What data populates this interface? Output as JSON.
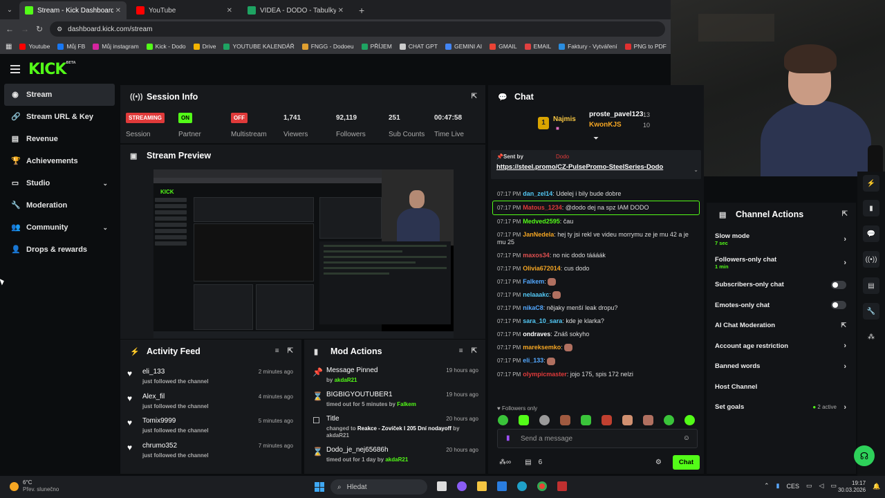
{
  "browser": {
    "tabs": [
      {
        "title": "Stream - Kick Dashboard",
        "color": "#53fc18",
        "active": true
      },
      {
        "title": "YouTube",
        "color": "#ff0000",
        "active": false
      },
      {
        "title": "VIDEA - DODO - Tabulky Googl",
        "color": "#1ea362",
        "active": false
      }
    ],
    "url": "dashboard.kick.com/stream",
    "bookmarks": [
      {
        "label": "Youtube",
        "color": "#ff0000"
      },
      {
        "label": "Můj FB",
        "color": "#1877f2"
      },
      {
        "label": "Můj instagram",
        "color": "#d6249f"
      },
      {
        "label": "Kick - Dodo",
        "color": "#53fc18"
      },
      {
        "label": "Drive",
        "color": "#f4b400"
      },
      {
        "label": "YOUTUBE KALENDÁŘ",
        "color": "#1ea362"
      },
      {
        "label": "FNGG - Dodoeu",
        "color": "#e0a030"
      },
      {
        "label": "PŘÍJEM",
        "color": "#1ea362"
      },
      {
        "label": "CHAT GPT",
        "color": "#cccccc"
      },
      {
        "label": "GEMINI AI",
        "color": "#4285f4"
      },
      {
        "label": "GMAIL",
        "color": "#ea4335"
      },
      {
        "label": "EMAIL",
        "color": "#e04040"
      },
      {
        "label": "Faktury - Vytváření",
        "color": "#2a8de0"
      },
      {
        "label": "PNG to PDF",
        "color": "#e03030"
      }
    ]
  },
  "logo": {
    "text": "KICK",
    "sup": "BETA"
  },
  "sidebar": [
    {
      "label": "Stream",
      "icon": "◉",
      "active": true,
      "chev": false
    },
    {
      "label": "Stream URL & Key",
      "icon": "🔗",
      "chev": false
    },
    {
      "label": "Revenue",
      "icon": "▤",
      "chev": false
    },
    {
      "label": "Achievements",
      "icon": "🏆",
      "chev": false
    },
    {
      "label": "Studio",
      "icon": "▭",
      "chev": true
    },
    {
      "label": "Moderation",
      "icon": "🔧",
      "chev": false
    },
    {
      "label": "Community",
      "icon": "👥",
      "chev": true
    },
    {
      "label": "Drops & rewards",
      "icon": "👤",
      "chev": false
    }
  ],
  "session": {
    "title": "Session Info",
    "stats": [
      {
        "badge": "STREAMING",
        "badge_color": "#e03a3a",
        "label": "Session"
      },
      {
        "badge": "ON",
        "badge_color": "#53fc18",
        "label": "Partner"
      },
      {
        "badge": "OFF",
        "badge_color": "#e03a3a",
        "label": "Multistream"
      },
      {
        "value": "1,741",
        "label": "Viewers"
      },
      {
        "value": "92,119",
        "label": "Followers"
      },
      {
        "value": "251",
        "label": "Sub Counts"
      },
      {
        "value": "00:47:58",
        "label": "Time Live"
      }
    ]
  },
  "preview": {
    "title": "Stream Preview"
  },
  "activity": {
    "title": "Activity Feed",
    "items": [
      {
        "name": "eli_133",
        "text": "just followed the channel",
        "time": "2 minutes ago"
      },
      {
        "name": "Alex_fil",
        "text": "just followed the channel",
        "time": "4 minutes ago"
      },
      {
        "name": "Tomix9999",
        "text": "just followed the channel",
        "time": "5 minutes ago"
      },
      {
        "name": "chrumo352",
        "text": "just followed the channel",
        "time": "7 minutes ago"
      }
    ]
  },
  "mod": {
    "title": "Mod Actions",
    "items": [
      {
        "icon": "📌",
        "name": "Message Pinned",
        "pre": "by",
        "target": "akdaR21",
        "post": "",
        "time": "19 hours ago",
        "h": 35
      },
      {
        "icon": "⌛",
        "name": "BIGBIGYOUTUBER1",
        "pre": "timed out for 5 minutes by",
        "target": "Falkem",
        "post": "",
        "time": "19 hours ago",
        "h": 35
      },
      {
        "icon": "☐",
        "name": "Title",
        "pre": "changed to",
        "target": "Reakce - Zovíček I 205 Dní nodayoff",
        "post": " by akdaR21",
        "time": "20 hours ago",
        "h": 45
      },
      {
        "icon": "⌛",
        "name": "Dodo_je_nej65686h",
        "pre": "timed out for 1 day by",
        "target": "akdaR21",
        "post": "",
        "time": "20 hours ago",
        "h": 30
      }
    ]
  },
  "chat": {
    "title": "Chat",
    "top": {
      "rank1": "Najmis",
      "rank1_count": "1",
      "second": "proste_pavel123",
      "second_count": "13",
      "third": "KwonKJS",
      "third_count": "10"
    },
    "pinned": {
      "label": "Sent by",
      "user": "Dodo",
      "link": "https://steel.promo/CZ-PulsePromo-SteelSeries-Dodo"
    },
    "messages": [
      {
        "time": "07:17 PM",
        "user": "dan_zel14",
        "color": "#53c8f5",
        "text": "Udelej i bily bude dobre"
      },
      {
        "time": "07:17 PM",
        "user": "Matous_1234",
        "color": "#e03a3a",
        "text": "@dodo dej na spz IAM DODO",
        "highlight": true
      },
      {
        "time": "07:17 PM",
        "user": "Medved2595",
        "color": "#53fc18",
        "text": "čau"
      },
      {
        "time": "07:17 PM",
        "user": "JanNedela",
        "color": "#f5a623",
        "text": "hej ty jsi rekl ve videu morrymu ze je mu 42 a je mu 25"
      },
      {
        "time": "07:17 PM",
        "user": "maxos34",
        "color": "#e05050",
        "text": "no nic dodo táááák"
      },
      {
        "time": "07:17 PM",
        "user": "Olivia672014",
        "color": "#f5a623",
        "text": "cus dodo"
      },
      {
        "time": "07:17 PM",
        "user": "Falkem",
        "color": "#53a8ff",
        "text": ""
      },
      {
        "time": "07:17 PM",
        "user": "nelaaakc",
        "color": "#53c8f5",
        "text": ""
      },
      {
        "time": "07:17 PM",
        "user": "nikaC8",
        "color": "#53a8ff",
        "text": "nějaky menší leak dropu?"
      },
      {
        "time": "07:17 PM",
        "user": "sara_10_sara",
        "color": "#53c8f5",
        "text": "kde je klarka?"
      },
      {
        "time": "07:17 PM",
        "user": "ondraves",
        "color": "#ffffff",
        "text": "Znáš sokyho"
      },
      {
        "time": "07:17 PM",
        "user": "mareksemko",
        "color": "#f5a623",
        "text": ""
      },
      {
        "time": "07:17 PM",
        "user": "eli_133",
        "color": "#53a8ff",
        "text": ""
      },
      {
        "time": "07:17 PM",
        "user": "olympicmaster",
        "color": "#e03a3a",
        "text": "jojo 175, spis 172 nelzi"
      }
    ],
    "mode": "Followers only",
    "input_placeholder": "Send a message",
    "viewers_count": "6",
    "send_label": "Chat"
  },
  "channel_actions": {
    "title": "Channel Actions",
    "items": [
      {
        "label": "Slow mode",
        "sub": "7 sec",
        "kind": "arrow"
      },
      {
        "label": "Followers-only chat",
        "sub": "1 min",
        "kind": "arrow"
      },
      {
        "label": "Subscribers-only chat",
        "sub": "",
        "kind": "toggle"
      },
      {
        "label": "Emotes-only chat",
        "sub": "",
        "kind": "toggle"
      },
      {
        "label": "AI Chat Moderation",
        "sub": "",
        "kind": "external"
      },
      {
        "label": "Account age restriction",
        "sub": "",
        "kind": "arrow"
      },
      {
        "label": "Banned words",
        "sub": "",
        "kind": "arrow"
      },
      {
        "label": "Host Channel",
        "sub": "",
        "kind": "none"
      },
      {
        "label": "Set goals",
        "sub": "",
        "kind": "goals",
        "extra": "2 active"
      }
    ]
  },
  "taskbar": {
    "weather_temp": "6°C",
    "weather_text": "Přev. slunečno",
    "search": "Hledat",
    "lang": "CES",
    "time": "19:17",
    "date": "30.03.2026"
  }
}
